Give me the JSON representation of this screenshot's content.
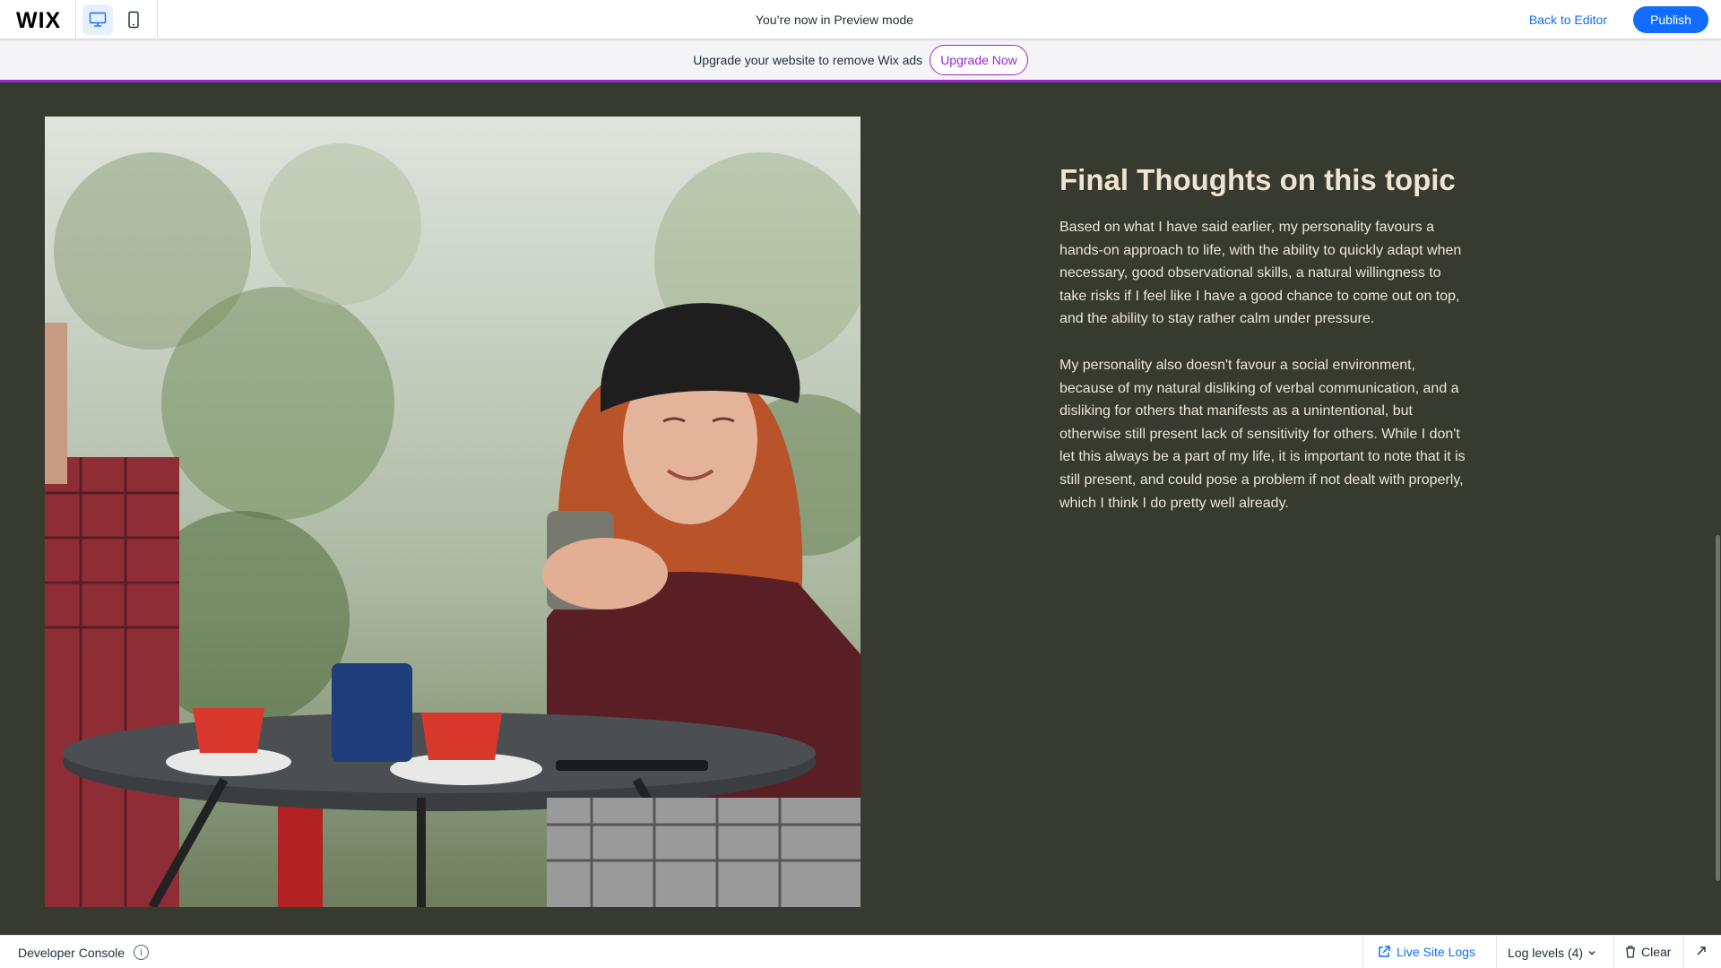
{
  "topbar": {
    "logo": "WIX",
    "desktop_icon": "desktop-icon",
    "mobile_icon": "mobile-icon",
    "preview_message": "You’re now in Preview mode",
    "back_to_editor": "Back to Editor",
    "publish": "Publish"
  },
  "ad_banner": {
    "message": "Upgrade your website to remove Wix ads",
    "button": "Upgrade Now"
  },
  "content": {
    "heading": "Final Thoughts on this topic",
    "paragraph1": "Based on what I have said earlier, my personality favours a hands-on approach to life, with the ability to quickly adapt when necessary, good observational skills, a natural willingness to take risks if I feel like I have a good chance to come out on top, and the ability to stay rather calm under pressure.",
    "paragraph2": "My personality also doesn't favour a social environment, because of my natural disliking of verbal communication, and a disliking for others that manifests as a unintentional, but otherwise still present lack of sensitivity for others. While I don't let this always be a part of my life, it is important to note that it is still present, and could pose a problem if not dealt with properly, which I think I do pretty well already."
  },
  "console": {
    "title": "Developer Console",
    "info_icon": "info-icon",
    "live_site_logs": "Live Site Logs",
    "log_levels": "Log levels (4)",
    "clear": "Clear",
    "expand_icon": "expand-icon"
  },
  "colors": {
    "accent_blue": "#116dff",
    "upgrade_purple": "#9a27d5",
    "site_background": "#363a2f",
    "heading_text": "#efe4cf"
  }
}
